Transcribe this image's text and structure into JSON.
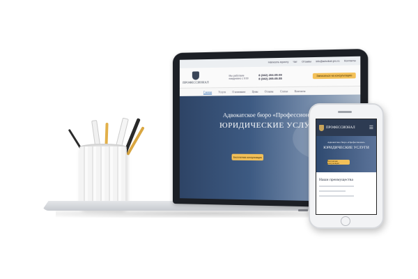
{
  "laptop_site": {
    "topbar": [
      "Написать юристу",
      "Чат",
      "Отзывы",
      "info@advokat-pro.ru",
      "Контакты"
    ],
    "header": {
      "logo_text": "ПРОФЕССИОНАЛ",
      "info_line1": "Мы работаем",
      "info_line2": "ежедневно с 9:00",
      "phone1": "8 (342) 204-05-09",
      "phone2": "8 (342) 205-05-55",
      "cta": "Записаться на консультацию"
    },
    "nav": [
      "Главная",
      "Услуги",
      "О компании",
      "Цены",
      "Отзывы",
      "Статьи",
      "Контакты"
    ],
    "hero": {
      "pretitle": "Адвокатское бюро «Профессионал»",
      "title": "ЮРИДИЧЕСКИЕ УСЛУГИ",
      "button": "Бесплатная консультация"
    }
  },
  "phone_site": {
    "logo_text": "ПРОФЕССИОНАЛ",
    "menu_icon": "hamburger-icon",
    "hero": {
      "pretitle": "Адвокатское бюро «Профессионал»",
      "title": "ЮРИДИЧЕСКИЕ УСЛУГИ",
      "button": "Бесплатная консультация"
    },
    "section_title": "Наши преимущества"
  },
  "colors": {
    "accent": "#f3c058",
    "hero_blue": "#2e4466",
    "laptop_body": "#1c1f25"
  }
}
